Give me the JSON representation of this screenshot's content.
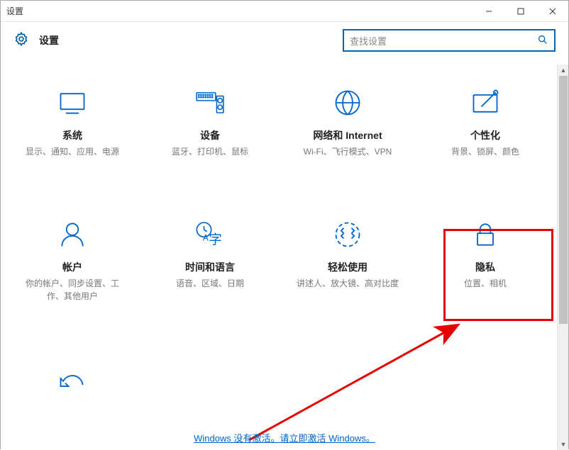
{
  "window": {
    "title": "设置"
  },
  "header": {
    "app_title": "设置"
  },
  "search": {
    "placeholder": "查找设置"
  },
  "tiles": [
    {
      "title": "系统",
      "sub": "显示、通知、应用、电源"
    },
    {
      "title": "设备",
      "sub": "蓝牙、打印机、鼠标"
    },
    {
      "title": "网络和 Internet",
      "sub": "Wi-Fi、飞行模式、VPN"
    },
    {
      "title": "个性化",
      "sub": "背景、锁屏、颜色"
    },
    {
      "title": "帐户",
      "sub": "你的帐户、同步设置、工作、其他用户"
    },
    {
      "title": "时间和语言",
      "sub": "语音、区域、日期"
    },
    {
      "title": "轻松使用",
      "sub": "讲述人、放大镜、高对比度"
    },
    {
      "title": "隐私",
      "sub": "位置、相机"
    }
  ],
  "activation": {
    "text": "Windows 没有激活。请立即激活 Windows。"
  }
}
